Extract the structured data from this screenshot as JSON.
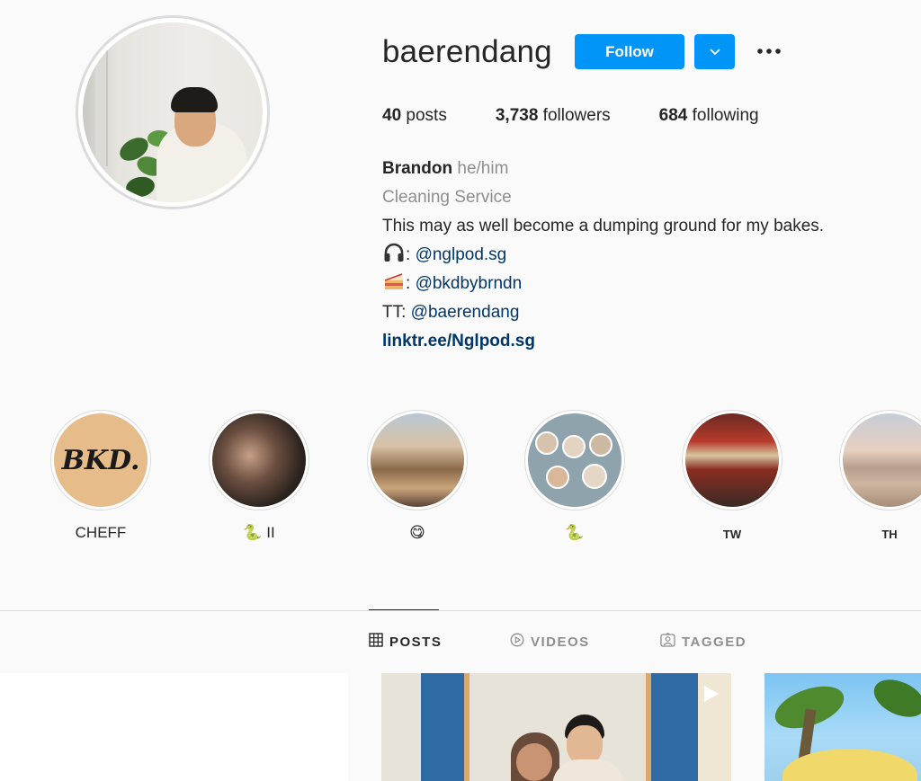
{
  "profile": {
    "username": "baerendang",
    "follow_label": "Follow",
    "more_icon": "more-horizontal-icon",
    "dropdown_icon": "chevron-down-icon"
  },
  "stats": {
    "posts_count": "40",
    "posts_label": "posts",
    "followers_count": "3,738",
    "followers_label": "followers",
    "following_count": "684",
    "following_label": "following"
  },
  "bio": {
    "name": "Brandon",
    "pronouns": "he/him",
    "category": "Cleaning Service",
    "line1": "This may as well become a dumping ground for my bakes.",
    "podcast_prefix": ":",
    "podcast_handle": "@nglpod.sg",
    "bakes_prefix": ":",
    "bakes_handle": "@bkdbybrndn",
    "tt_prefix": "TT:",
    "tt_handle": "@baerendang",
    "website": "linktr.ee/Nglpod.sg"
  },
  "highlights": [
    {
      "label": "CHEFF",
      "logo_text": "BKD."
    },
    {
      "label": "🐍 II"
    },
    {
      "label": "😋"
    },
    {
      "label": "🐍"
    },
    {
      "label": "TW"
    },
    {
      "label": "TH"
    }
  ],
  "tabs": {
    "posts": "POSTS",
    "videos": "VIDEOS",
    "tagged": "TAGGED"
  },
  "colors": {
    "primary": "#0095f6",
    "link": "#00376b",
    "text": "#262626",
    "muted": "#8e8e8e",
    "border": "#dbdbdb"
  }
}
